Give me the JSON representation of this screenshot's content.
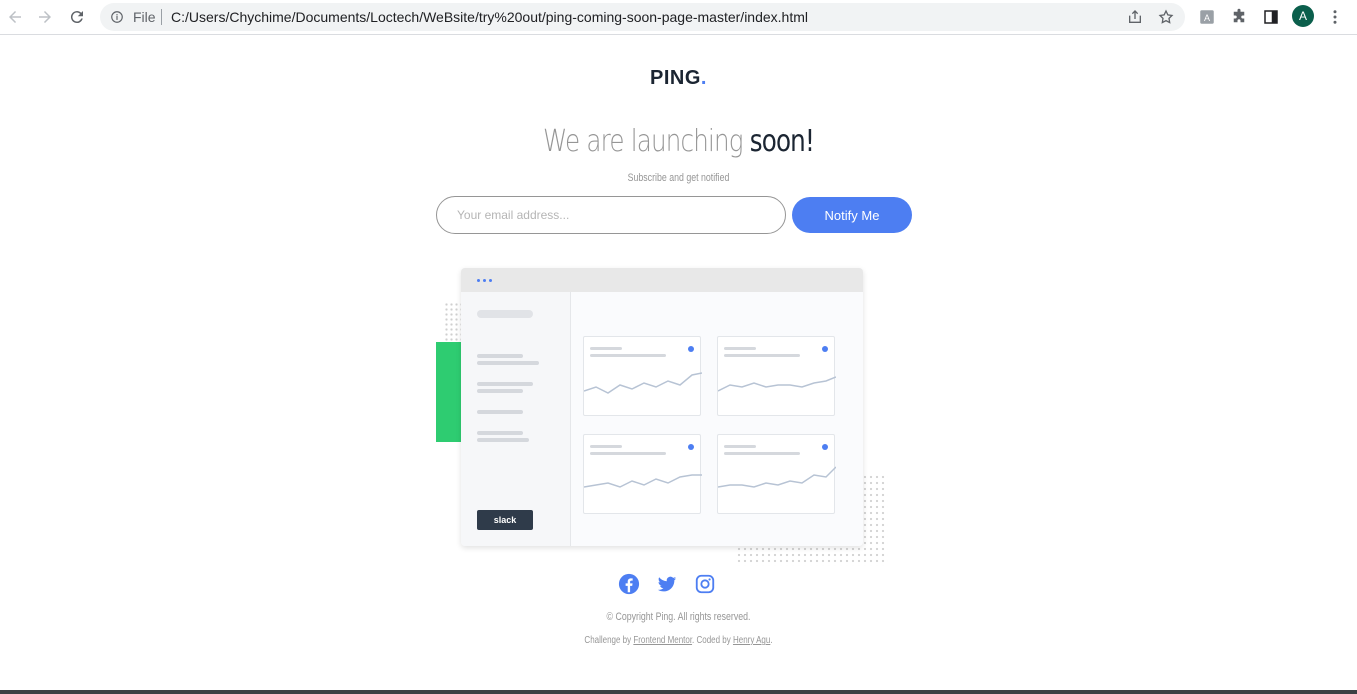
{
  "browser": {
    "file_label": "File",
    "url": "C:/Users/Chychime/Documents/Loctech/WeBsite/try%20out/ping-coming-soon-page-master/index.html",
    "profile_initial": "A"
  },
  "page": {
    "logo": "PING",
    "logo_dot": ".",
    "headline_light": "We are launching",
    "headline_strong": "soon!",
    "subtitle": "Subscribe and get notified",
    "email_placeholder": "Your email address...",
    "notify_label": "Notify Me",
    "illustration": {
      "slack_label": "slack"
    },
    "social": [
      "facebook-icon",
      "twitter-icon",
      "instagram-icon"
    ],
    "copyright": "© Copyright Ping. All rights reserved.",
    "credits_prefix": "Challenge by",
    "credits_link1": "Frontend Mentor",
    "credits_mid": ". Coded by",
    "credits_link2": "Henry Agu",
    "credits_suffix": "."
  },
  "colors": {
    "accent": "#4d7ef2",
    "green": "#2ecc71",
    "dark": "#1b2532",
    "gray": "#969696"
  }
}
